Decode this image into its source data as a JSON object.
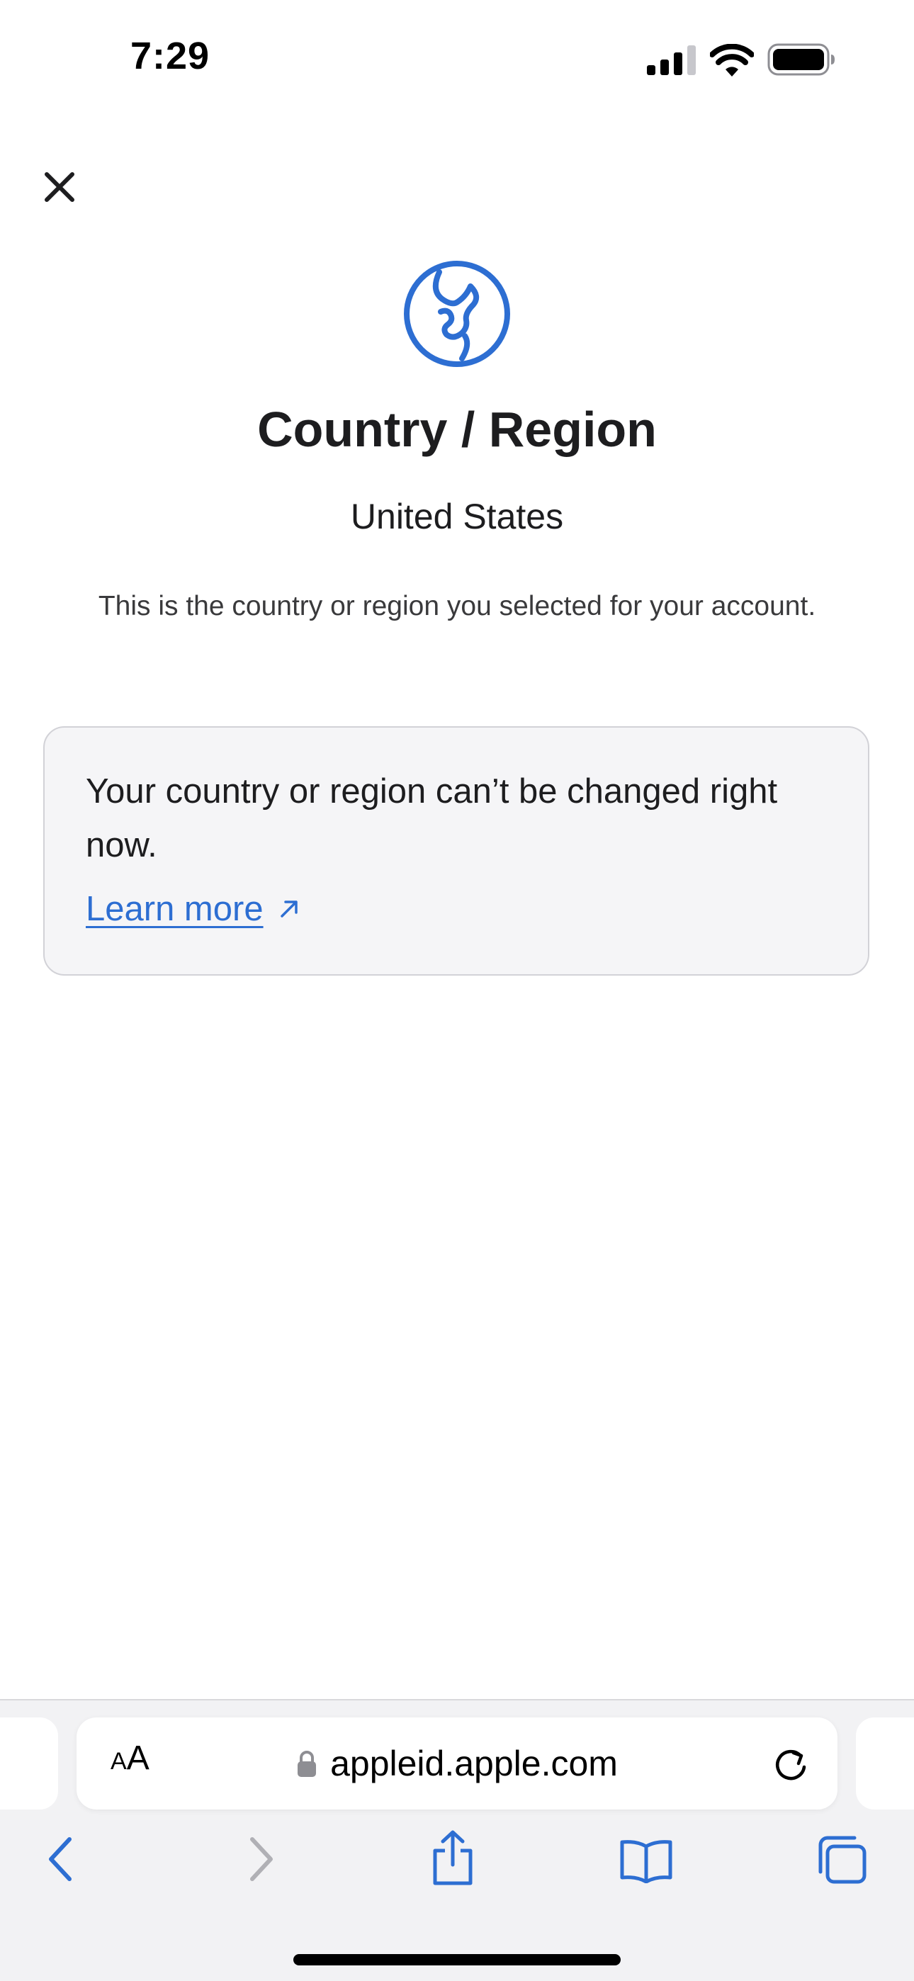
{
  "status_bar": {
    "time": "7:29",
    "icons": [
      "cellular-signal-icon",
      "wifi-icon",
      "battery-icon"
    ]
  },
  "header": {
    "close_icon": "close-icon"
  },
  "hero": {
    "icon": "globe-icon",
    "title": "Country / Region",
    "value": "United States",
    "description": "This is the country or region you selected for your account."
  },
  "notice": {
    "message": "Your country or region can’t be changed right now.",
    "link_label": "Learn more",
    "link_icon": "external-arrow-icon"
  },
  "safari": {
    "reader_small": "A",
    "reader_large": "A",
    "url": "appleid.apple.com",
    "lock_icon": "lock-icon",
    "reload_icon": "reload-icon",
    "toolbar": [
      "back-icon",
      "forward-icon",
      "share-icon",
      "bookmarks-icon",
      "tabs-icon"
    ]
  },
  "colors": {
    "accent": "#2D6ED2",
    "card_background": "#F5F5F7",
    "card_border": "#D2D2D7",
    "toolbar_background": "#F2F2F4",
    "disabled": "#B0B0B5"
  }
}
